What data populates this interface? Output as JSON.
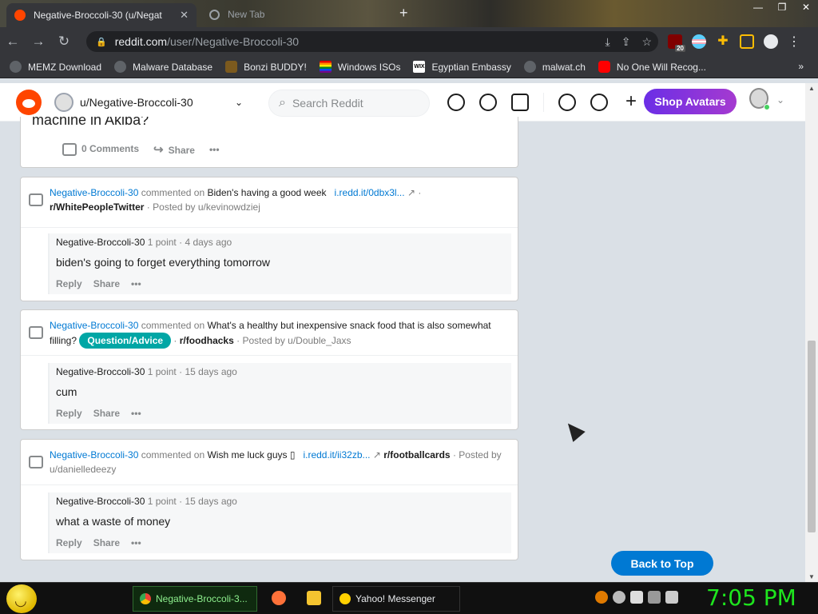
{
  "browser": {
    "tabs": [
      {
        "title": "Negative-Broccoli-30 (u/Negat",
        "active": true
      },
      {
        "title": "New Tab",
        "active": false
      }
    ],
    "url_domain": "reddit.com",
    "url_path": "/user/Negative-Broccoli-30",
    "extension_badge": "20",
    "bookmarks": [
      {
        "label": "MEMZ Download",
        "icon": "globe-icon"
      },
      {
        "label": "Malware Database",
        "icon": "globe-icon"
      },
      {
        "label": "Bonzi BUDDY!",
        "icon": "bonzi-icon"
      },
      {
        "label": "Windows ISOs",
        "icon": "rainbow-icon"
      },
      {
        "label": "Egyptian Embassy",
        "icon": "wix-icon"
      },
      {
        "label": "malwat.ch",
        "icon": "globe-icon"
      },
      {
        "label": "No One Will Recog...",
        "icon": "youtube-icon"
      }
    ],
    "bookmarks_more": "»"
  },
  "reddit_header": {
    "user_dropdown": "u/Negative-Broccoli-30",
    "search_placeholder": "Search Reddit",
    "shop_button": "Shop Avatars"
  },
  "partial_post": {
    "title_fragment": "machine in Akiba?",
    "comments": "0 Comments",
    "share": "Share",
    "more": "•••"
  },
  "activity": [
    {
      "author": "Negative-Broccoli-30",
      "commented_on": "commented on",
      "post_title": "Biden's having a good week",
      "link": "i.redd.it/0dbx3l...",
      "subreddit": "r/WhitePeopleTwitter",
      "posted_by": "Posted by u/kevinowdziej",
      "comment_author": "Negative-Broccoli-30",
      "points": "1 point",
      "age": "4 days ago",
      "body": "biden's going to forget everything tomorrow"
    },
    {
      "author": "Negative-Broccoli-30",
      "commented_on": "commented on",
      "post_title": "What's a healthy but inexpensive snack food that is also somewhat filling?",
      "flair": "Question/Advice",
      "subreddit": "r/foodhacks",
      "posted_by": "Posted by u/Double_Jaxs",
      "comment_author": "Negative-Broccoli-30",
      "points": "1 point",
      "age": "15 days ago",
      "body": "cum"
    },
    {
      "author": "Negative-Broccoli-30",
      "commented_on": "commented on",
      "post_title": "Wish me luck guys",
      "link": "i.redd.it/ii32zb...",
      "subreddit": "r/footballcards",
      "posted_by": "Posted by u/danielledeezy",
      "comment_author": "Negative-Broccoli-30",
      "points": "1 point",
      "age": "15 days ago",
      "body": "what a waste of money"
    }
  ],
  "comment_actions": {
    "reply": "Reply",
    "share": "Share",
    "more": "•••"
  },
  "back_to_top": "Back to Top",
  "taskbar": {
    "chrome_task": "Negative-Broccoli-3...",
    "yahoo_task": "Yahoo! Messenger",
    "clock": "7:05 PM"
  },
  "colors": {
    "reddit_orange": "#ff4500",
    "link_blue": "#0079d3",
    "flair_teal": "#00a6a5",
    "clock_green": "#1ee51e"
  }
}
